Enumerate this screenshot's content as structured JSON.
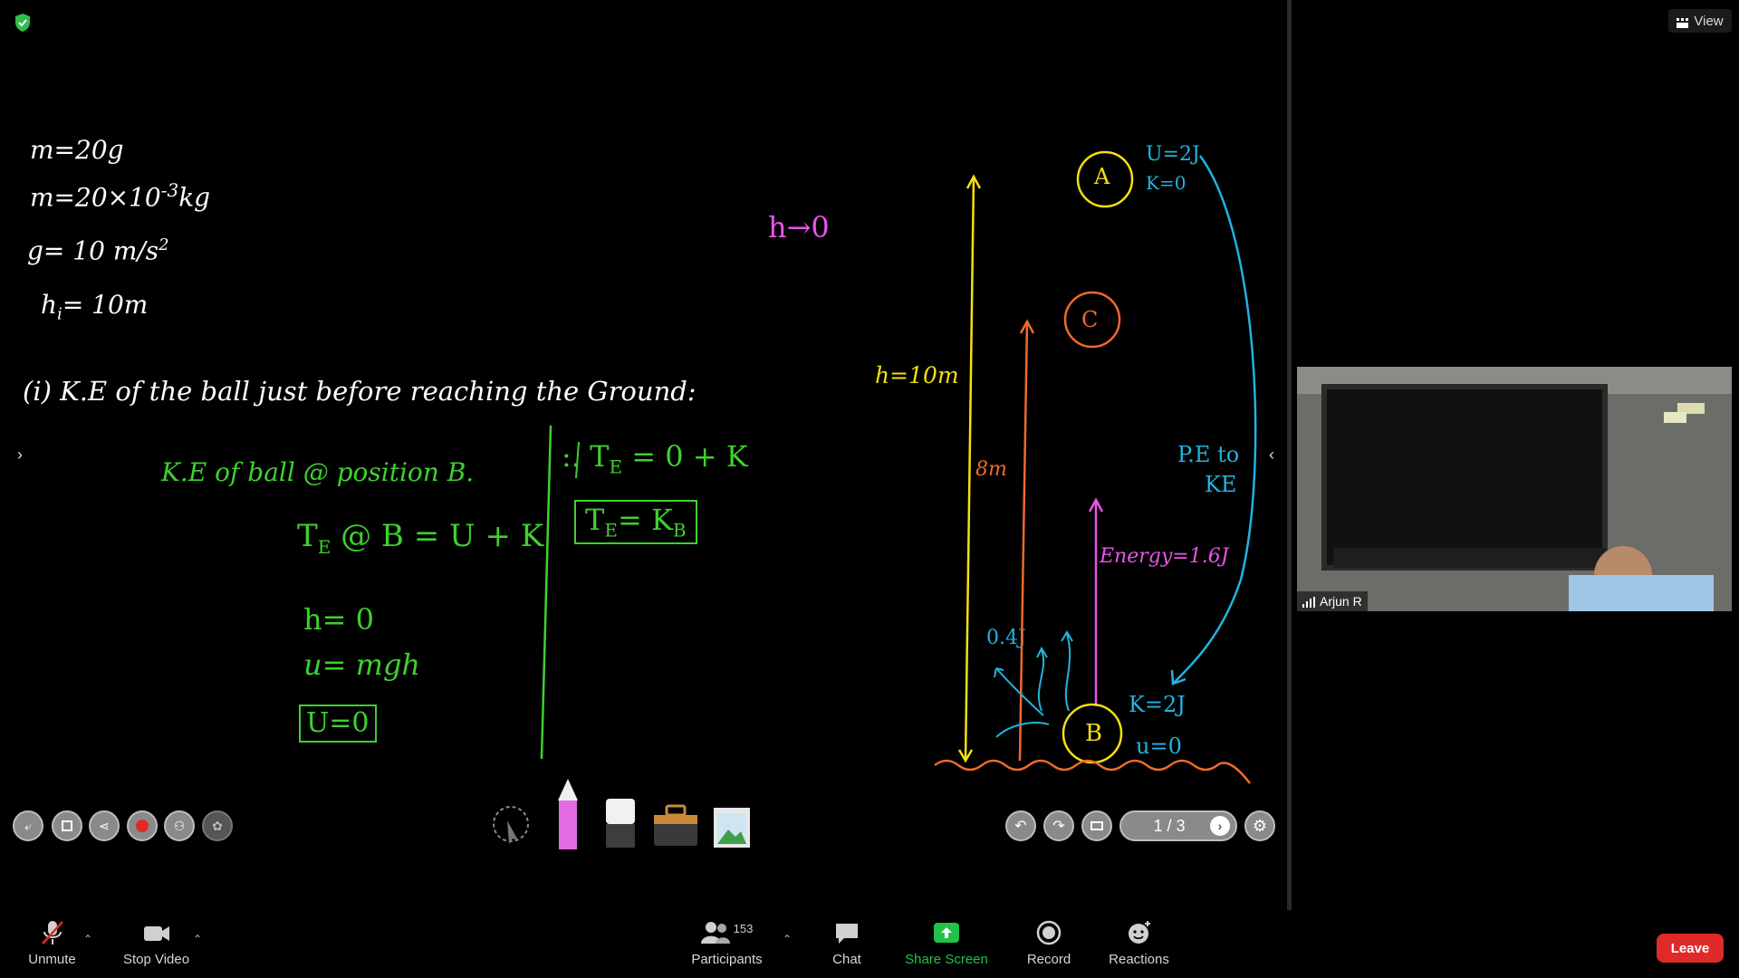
{
  "colors": {
    "white_ink": "#ffffff",
    "green_ink": "#3ed12f",
    "yellow_ink": "#f4e10e",
    "orange_ink": "#ef6a2a",
    "magenta_ink": "#e855e8",
    "cyan_ink": "#20b4e0",
    "leave_button": "#e02a2a",
    "share_green": "#22c14a"
  },
  "top": {
    "view_label": "View"
  },
  "whiteboard": {
    "given": {
      "m1": "m=20g",
      "m2": "m=20×10",
      "m2_exp": "-3",
      "m2_unit": "kg",
      "g": "g= 10 m/s",
      "g_exp": "2",
      "h": "h",
      "h_sub": "i",
      "h_val": "= 10m"
    },
    "question": "(i) K.E of the ball just before reaching the Ground:",
    "ke_line": "K.E of ball @ position B.",
    "te_line": "T",
    "te_sub": "E",
    "te_rest": "@ B = U + K",
    "h0": "h= 0",
    "umgh": "u= mgh",
    "u0": "U=0",
    "te0k": ":. T",
    "te0k_sub": "E",
    "te0k_rest": "= 0 + K",
    "tekb": "T",
    "tekb_sub": "E",
    "tekb_mid": "= K",
    "tekb_sub2": "B",
    "h_to_0": "h→0",
    "h10": "h=10m",
    "eight_m": "8m",
    "label_a": "A",
    "label_c": "C",
    "label_b": "B",
    "u2j": "U=2J",
    "k0": "K=0",
    "pe_to": "P.E to",
    "ke": "KE",
    "energy": "Energy=1.6J",
    "q04": "0.4J",
    "k2j": "K=2J",
    "u_0": "u=0"
  },
  "wb_toolbar": {
    "page_indicator": "1 / 3"
  },
  "participant": {
    "name": "Arjun R"
  },
  "bottom_bar": {
    "unmute": "Unmute",
    "stop_video": "Stop Video",
    "participants_count": "153",
    "participants": "Participants",
    "chat": "Chat",
    "share_screen": "Share Screen",
    "record": "Record",
    "reactions": "Reactions",
    "leave": "Leave"
  }
}
